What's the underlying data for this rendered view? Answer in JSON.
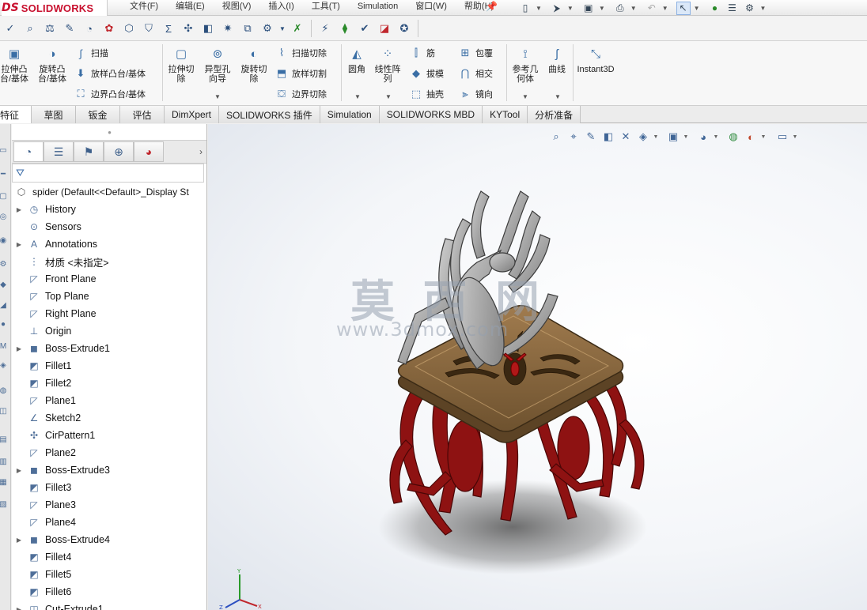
{
  "app": {
    "logo_ds": "DS",
    "logo_name": "SOLIDWORKS"
  },
  "menus": [
    "文件(F)",
    "编辑(E)",
    "视图(V)",
    "插入(I)",
    "工具(T)",
    "Simulation",
    "窗口(W)",
    "帮助(H)"
  ],
  "quick_icons": [
    "new-icon",
    "open-icon",
    "save-icon",
    "print-icon",
    "undo-icon",
    "select-icon",
    "rebuild-icon",
    "file-properties-icon",
    "options-icon"
  ],
  "commands": {
    "extrude_boss": "拉伸凸台/基体",
    "revolve_boss": "旋转凸台/基体",
    "sweep": "扫描",
    "loft_boss": "放样凸台/基体",
    "boundary_boss": "边界凸台/基体",
    "extrude_cut": "拉伸切除",
    "hole_wizard": "异型孔向导",
    "revolve_cut": "旋转切除",
    "sweep_cut": "扫描切除",
    "loft_cut": "放样切割",
    "boundary_cut": "边界切除",
    "fillet": "圆角",
    "linear_pattern": "线性阵列",
    "rib": "筋",
    "draft": "拔模",
    "shell": "抽壳",
    "wrap": "包覆",
    "intersect": "相交",
    "mirror": "镜向",
    "reference_geometry": "参考几何体",
    "curves": "曲线",
    "instant3d": "Instant3D"
  },
  "tabs": [
    {
      "label": "特征",
      "active": true
    },
    {
      "label": "草图",
      "active": false
    },
    {
      "label": "钣金",
      "active": false
    },
    {
      "label": "评估",
      "active": false
    },
    {
      "label": "DimXpert",
      "active": false
    },
    {
      "label": "SOLIDWORKS 插件",
      "active": false
    },
    {
      "label": "Simulation",
      "active": false
    },
    {
      "label": "SOLIDWORKS MBD",
      "active": false
    },
    {
      "label": "KYTool",
      "active": false
    },
    {
      "label": "分析准备",
      "active": false
    }
  ],
  "tree": {
    "root": "spider  (Default<<Default>_Display St",
    "items": [
      {
        "label": "History",
        "icon": "history-icon",
        "expandable": true
      },
      {
        "label": "Sensors",
        "icon": "sensors-icon",
        "expandable": false
      },
      {
        "label": "Annotations",
        "icon": "annotations-icon",
        "expandable": true
      },
      {
        "label": "材质 <未指定>",
        "icon": "material-icon",
        "expandable": false
      },
      {
        "label": "Front Plane",
        "icon": "plane-icon",
        "expandable": false
      },
      {
        "label": "Top Plane",
        "icon": "plane-icon",
        "expandable": false
      },
      {
        "label": "Right Plane",
        "icon": "plane-icon",
        "expandable": false
      },
      {
        "label": "Origin",
        "icon": "origin-icon",
        "expandable": false
      },
      {
        "label": "Boss-Extrude1",
        "icon": "extrude-icon",
        "expandable": true
      },
      {
        "label": "Fillet1",
        "icon": "fillet-icon",
        "expandable": false
      },
      {
        "label": "Fillet2",
        "icon": "fillet-icon",
        "expandable": false
      },
      {
        "label": "Plane1",
        "icon": "plane-icon",
        "expandable": false
      },
      {
        "label": "Sketch2",
        "icon": "sketch-icon",
        "expandable": false
      },
      {
        "label": "CirPattern1",
        "icon": "circular-pattern-icon",
        "expandable": false
      },
      {
        "label": "Plane2",
        "icon": "plane-icon",
        "expandable": false
      },
      {
        "label": "Boss-Extrude3",
        "icon": "extrude-icon",
        "expandable": true
      },
      {
        "label": "Fillet3",
        "icon": "fillet-icon",
        "expandable": false
      },
      {
        "label": "Plane3",
        "icon": "plane-icon",
        "expandable": false
      },
      {
        "label": "Plane4",
        "icon": "plane-icon",
        "expandable": false
      },
      {
        "label": "Boss-Extrude4",
        "icon": "extrude-icon",
        "expandable": true
      },
      {
        "label": "Fillet4",
        "icon": "fillet-icon",
        "expandable": false
      },
      {
        "label": "Fillet5",
        "icon": "fillet-icon",
        "expandable": false
      },
      {
        "label": "Fillet6",
        "icon": "fillet-icon",
        "expandable": false
      },
      {
        "label": "Cut-Extrude1",
        "icon": "cut-extrude-icon",
        "expandable": true
      }
    ]
  },
  "watermark": {
    "title": "莫 西 网",
    "url": "www.3dmox.com"
  },
  "colors": {
    "brand_red": "#c8102e",
    "spider_gray": "#8c8c8c",
    "table_top": "#8b6a44",
    "legs_red": "#8e1212"
  }
}
